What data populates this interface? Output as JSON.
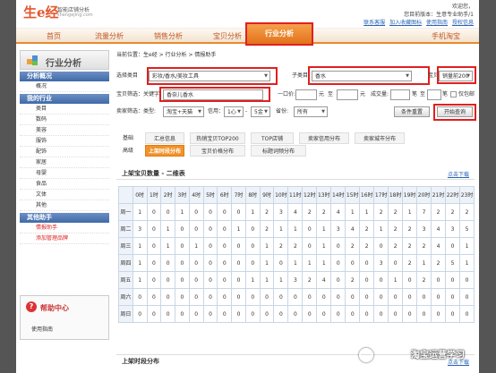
{
  "header": {
    "logo": "生e经",
    "tagline": "智能店铺分析",
    "tagline_sub": "shengejing.com",
    "greeting": "欢迎您，",
    "greeting2": "您目前版本：",
    "greeting3": "生意专业助手/1",
    "links": [
      "联系客服",
      "加入收藏图标",
      "使用指南",
      "授权信息"
    ]
  },
  "nav": {
    "items": [
      "首页",
      "流量分析",
      "销售分析",
      "宝贝分析",
      "行业分析",
      "手机淘宝"
    ]
  },
  "sidebar": {
    "title": "行业分析",
    "sections": [
      {
        "title": "分析概况",
        "items": [
          "概况"
        ]
      },
      {
        "title": "我的行业",
        "items": [
          "类目",
          "数码",
          "美容",
          "服饰",
          "配饰",
          "家居",
          "母婴",
          "食品",
          "文体",
          "其他"
        ]
      }
    ],
    "tool_section": "其他助手",
    "tool_items": [
      "情报助手",
      "添加管理品牌"
    ],
    "help_title": "帮助中心",
    "help_link": "使用指南"
  },
  "main": {
    "breadcrumb": "当前位置：生e经 > 行业分析 > 情报助手",
    "filters": {
      "category_label": "选择类目",
      "category_value": "彩妆/香水/美妆工具",
      "sub_label": "子类目",
      "sub_value": "香水",
      "baby_label": "宝贝",
      "sort_value": "销量前200",
      "keyword_label": "宝贝筛选：关键字",
      "keyword_value": "香奈儿香水",
      "price_label": "一口价:",
      "price_unit": "元",
      "price_to": "至",
      "price_unit2": "元",
      "deal_label": "成交量:",
      "deal_unit": "笔",
      "deal_to": "至",
      "deal_unit2": "笔",
      "only_label": "仅包邮",
      "seller_label": "卖家筛选：类型:",
      "seller_type": "淘宝+天猫",
      "credit_label": "信用：",
      "credit_from": "1心",
      "credit_to": "5金",
      "province_label": "省份:",
      "province_value": "所有",
      "reset_button": "条件重置",
      "query_button": "开始查询"
    },
    "tabs_row1_labels": [
      "基础",
      "汇总信息",
      "热销宝贝TOP200",
      "TOP店铺",
      "卖家信用分布",
      "卖家城市分布"
    ],
    "tabs_row2_labels": [
      "高级",
      "上架时段分布",
      "宝贝价格分布",
      "标题词频分布"
    ],
    "section1_title": "上架宝贝数量 - 二维表",
    "section1_link": "点击下载",
    "hours": [
      "0时",
      "1时",
      "2时",
      "3时",
      "4时",
      "5时",
      "6时",
      "7时",
      "8时",
      "9时",
      "10时",
      "11时",
      "12时",
      "13时",
      "14时",
      "15时",
      "16时",
      "17时",
      "18时",
      "19时",
      "20时",
      "21时",
      "22时",
      "23时"
    ],
    "days": [
      "周一",
      "周二",
      "周三",
      "周四",
      "周五",
      "周六",
      "周日"
    ],
    "matrix": [
      [
        "1",
        "0",
        "0",
        "1",
        "0",
        "0",
        "0",
        "0",
        "1",
        "2",
        "3",
        "4",
        "2",
        "2",
        "4",
        "1",
        "1",
        "2",
        "2",
        "1",
        "7",
        "2",
        "2",
        "2"
      ],
      [
        "3",
        "0",
        "1",
        "0",
        "0",
        "0",
        "0",
        "1",
        "0",
        "2",
        "1",
        "1",
        "0",
        "1",
        "3",
        "4",
        "2",
        "1",
        "2",
        "2",
        "3",
        "4",
        "3",
        "5"
      ],
      [
        "1",
        "0",
        "1",
        "0",
        "1",
        "0",
        "0",
        "0",
        "0",
        "1",
        "2",
        "2",
        "0",
        "1",
        "0",
        "2",
        "2",
        "0",
        "2",
        "2",
        "2",
        "4",
        "0",
        "1"
      ],
      [
        "1",
        "0",
        "0",
        "0",
        "0",
        "0",
        "0",
        "0",
        "0",
        "1",
        "0",
        "1",
        "1",
        "1",
        "0",
        "0",
        "0",
        "3",
        "0",
        "2",
        "1",
        "2",
        "5",
        "1"
      ],
      [
        "1",
        "0",
        "0",
        "0",
        "0",
        "0",
        "0",
        "0",
        "1",
        "1",
        "1",
        "3",
        "2",
        "4",
        "0",
        "2",
        "0",
        "0",
        "1",
        "0",
        "2",
        "0",
        "0",
        "0"
      ],
      [
        "0",
        "0",
        "0",
        "0",
        "0",
        "0",
        "0",
        "0",
        "0",
        "0",
        "0",
        "0",
        "0",
        "0",
        "0",
        "0",
        "0",
        "0",
        "0",
        "0",
        "0",
        "0",
        "0",
        "0"
      ],
      [
        "0",
        "0",
        "0",
        "0",
        "0",
        "0",
        "0",
        "0",
        "0",
        "0",
        "0",
        "0",
        "0",
        "0",
        "0",
        "0",
        "0",
        "0",
        "0",
        "0",
        "0",
        "0",
        "0",
        "0"
      ]
    ],
    "section2_title": "上架时段分布",
    "section2_link": "点击下载"
  },
  "watermark": "淘宝运营学习",
  "colors": {
    "accent": "#e98a2e",
    "highlight": "#e02020",
    "link": "#2a64b5",
    "sidebar": "#3f6aa8"
  }
}
